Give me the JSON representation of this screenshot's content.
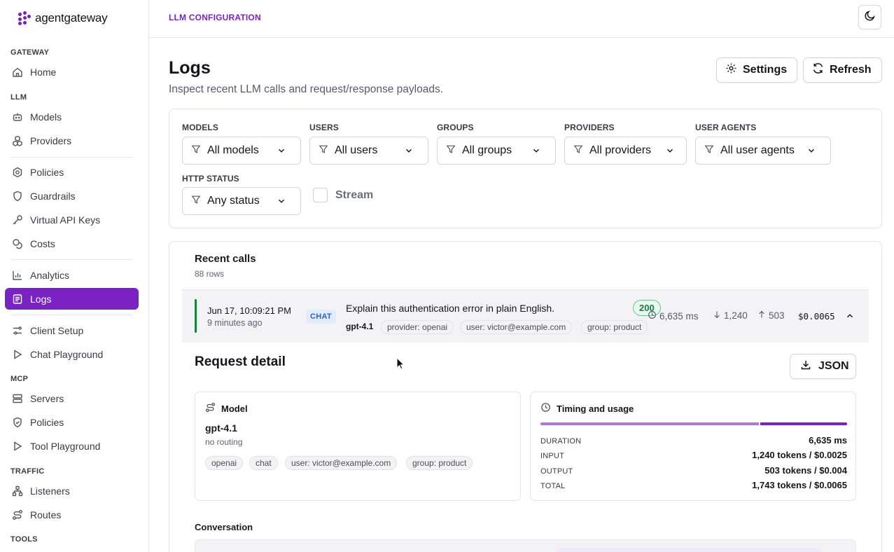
{
  "brand": {
    "name": "agentgateway",
    "accent": "#7b22c4"
  },
  "topbar": {
    "title": "LLM CONFIGURATION",
    "theme_icon": "moon-icon"
  },
  "sidebar": {
    "sections": {
      "gateway": "GATEWAY",
      "llm": "LLM",
      "mcp": "MCP",
      "traffic": "TRAFFIC",
      "tools": "TOOLS"
    },
    "items": {
      "home": "Home",
      "models": "Models",
      "providers": "Providers",
      "policies": "Policies",
      "guardrails": "Guardrails",
      "virtual_keys": "Virtual API Keys",
      "costs": "Costs",
      "analytics": "Analytics",
      "logs": "Logs",
      "client_setup": "Client Setup",
      "chat_playground": "Chat Playground",
      "servers": "Servers",
      "mcp_policies": "Policies",
      "tool_playground": "Tool Playground",
      "listeners": "Listeners",
      "routes": "Routes"
    },
    "active": "logs"
  },
  "header": {
    "title": "Logs",
    "subtitle": "Inspect recent LLM calls and request/response payloads.",
    "settings_label": "Settings",
    "refresh_label": "Refresh"
  },
  "filters": {
    "models": {
      "label": "MODELS",
      "value": "All models"
    },
    "users": {
      "label": "USERS",
      "value": "All users"
    },
    "groups": {
      "label": "GROUPS",
      "value": "All groups"
    },
    "providers": {
      "label": "PROVIDERS",
      "value": "All providers"
    },
    "user_agents": {
      "label": "USER AGENTS",
      "value": "All user agents"
    },
    "http_status": {
      "label": "HTTP STATUS",
      "value": "Any status"
    },
    "stream": {
      "label": "Stream",
      "checked": false
    }
  },
  "recent": {
    "title": "Recent calls",
    "count": "88 rows",
    "row": {
      "date": "Jun 17, 10:09:21 PM",
      "ago": "9 minutes ago",
      "kind": "CHAT",
      "prompt": "Explain this authentication error in plain English.",
      "model": "gpt-4.1",
      "chips": [
        "provider: openai",
        "user: victor@example.com",
        "group: product"
      ],
      "status": "200",
      "duration": "6,635 ms",
      "tokens_in": "1,240",
      "tokens_out": "503",
      "cost": "$0.0065",
      "status_color": "#16803c"
    }
  },
  "detail": {
    "title": "Request detail",
    "json_label": "JSON",
    "model_card": {
      "heading": "Model",
      "name": "gpt-4.1",
      "routing": "no routing",
      "tags": [
        "openai",
        "chat",
        "user: victor@example.com",
        "group: product"
      ]
    },
    "timing_card": {
      "heading": "Timing and usage",
      "input_share": 0.712,
      "rows": [
        {
          "k": "DURATION",
          "v": "6,635 ms"
        },
        {
          "k": "INPUT",
          "v": "1,240 tokens / $0.0025"
        },
        {
          "k": "OUTPUT",
          "v": "503 tokens / $0.004"
        },
        {
          "k": "TOTAL",
          "v": "1,743 tokens / $0.0065"
        }
      ]
    },
    "conversation_title": "Conversation"
  }
}
